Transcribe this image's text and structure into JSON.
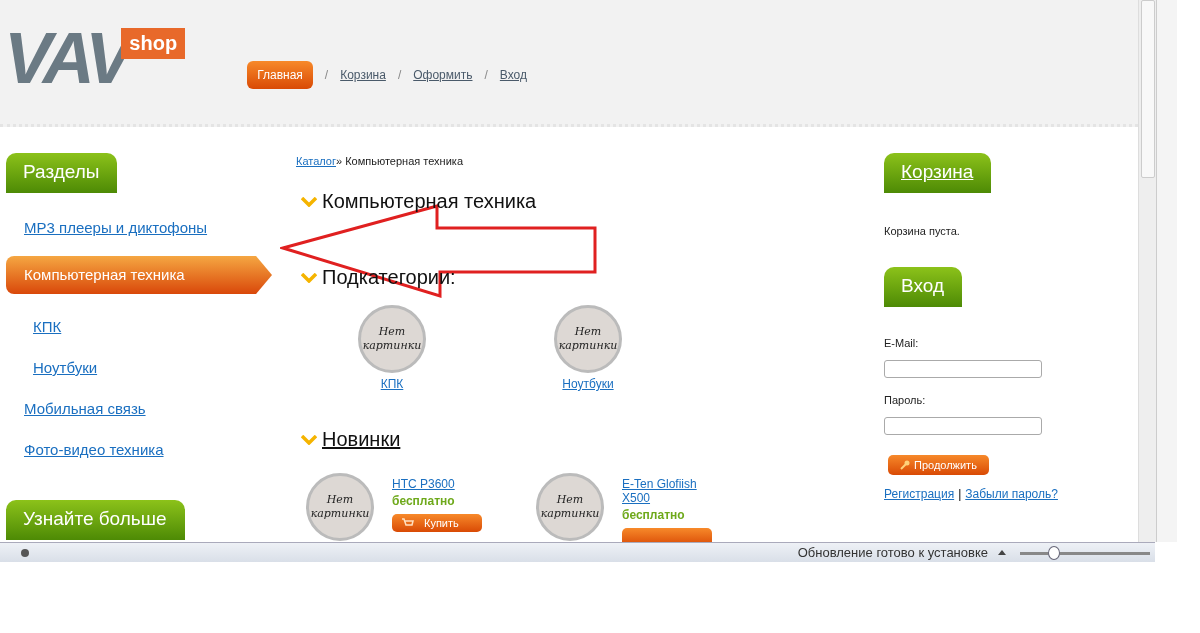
{
  "logo": {
    "wordmark": "VAV",
    "tag": "shop"
  },
  "nav_separator": "/",
  "nav": [
    {
      "label": "Главная",
      "selected": true
    },
    {
      "label": "Корзина",
      "selected": false
    },
    {
      "label": "Оформить",
      "selected": false
    },
    {
      "label": "Вход",
      "selected": false
    }
  ],
  "sidebar": {
    "title": "Разделы",
    "items": [
      {
        "label": "MP3 плееры и диктофоны",
        "selected": false
      },
      {
        "label": "Компьютерная техника",
        "selected": true,
        "children": [
          {
            "label": "КПК",
            "selected": false
          },
          {
            "label": "Ноутбуки",
            "selected": false
          }
        ]
      },
      {
        "label": "Мобильная связь",
        "selected": false
      },
      {
        "label": "Фото-видео техника",
        "selected": false
      }
    ],
    "more_title": "Узнайте больше"
  },
  "breadcrumb": {
    "link": "Каталог",
    "separator": "»",
    "current": "Компьютерная техника"
  },
  "heading": "Компьютерная техника",
  "subcategories": {
    "title": "Подкатегории:",
    "items": [
      {
        "image_text": "Нет картинки",
        "label": "КПК"
      },
      {
        "image_text": "Нет картинки",
        "label": "Ноутбуки"
      }
    ]
  },
  "new_items": {
    "title": "Новинки",
    "products": [
      {
        "image_text": "Нет картинки",
        "name": "HTC P3600",
        "price": "бесплатно",
        "button": {
          "label": "Купить",
          "label_hidden": false
        }
      },
      {
        "image_text": "Нет картинки",
        "name": "E-Ten Glofiish X500",
        "price": "бесплатно",
        "button": {
          "label_hidden": true
        }
      }
    ]
  },
  "cart": {
    "title": "Корзина",
    "text": "Корзина пуста."
  },
  "login": {
    "title": "Вход",
    "email_label": "E-Mail:",
    "password_label": "Пароль:",
    "submit": "Продолжить",
    "register": "Регистрация",
    "separator": "|",
    "forgot": "Забыли пароль?"
  },
  "status_bar": {
    "text": "Обновление готово к установке",
    "zoom": {
      "level": 0.25
    }
  }
}
